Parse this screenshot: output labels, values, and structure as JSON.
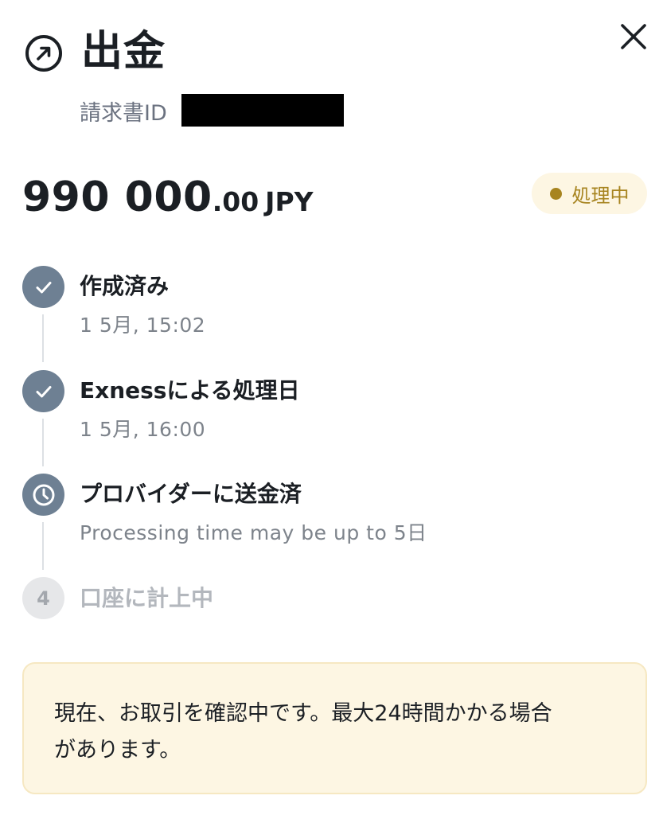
{
  "header": {
    "title": "出金",
    "icon": "arrow-up-right-circle-icon",
    "close_icon": "close-icon"
  },
  "invoice": {
    "label": "請求書ID"
  },
  "amount": {
    "integer": "990 000",
    "fraction": ".00",
    "currency": "JPY"
  },
  "status": {
    "label": "処理中",
    "color": "#a7841f",
    "background": "#fdf6e3"
  },
  "steps": [
    {
      "title": "作成済み",
      "subtitle": "1 5月, 15:02",
      "state": "done",
      "icon": "check-icon"
    },
    {
      "title": "Exnessによる処理日",
      "subtitle": "1 5月, 16:00",
      "state": "done",
      "icon": "check-icon"
    },
    {
      "title": "プロバイダーに送金済",
      "subtitle": "Processing time may be up to 5日",
      "state": "in-progress",
      "icon": "clock-icon"
    },
    {
      "title": "口座に計上中",
      "number": "4",
      "state": "pending"
    }
  ],
  "notice": {
    "text_line1": "現在、お取引を確認中です。最大24時間かかる場合",
    "text_line2": "があります。"
  },
  "colors": {
    "step_done": "#6e8093",
    "step_pending": "#e6e7e9",
    "notice_bg": "#fdf6e3",
    "text_primary": "#1b1f24",
    "text_secondary": "#7d838b"
  }
}
